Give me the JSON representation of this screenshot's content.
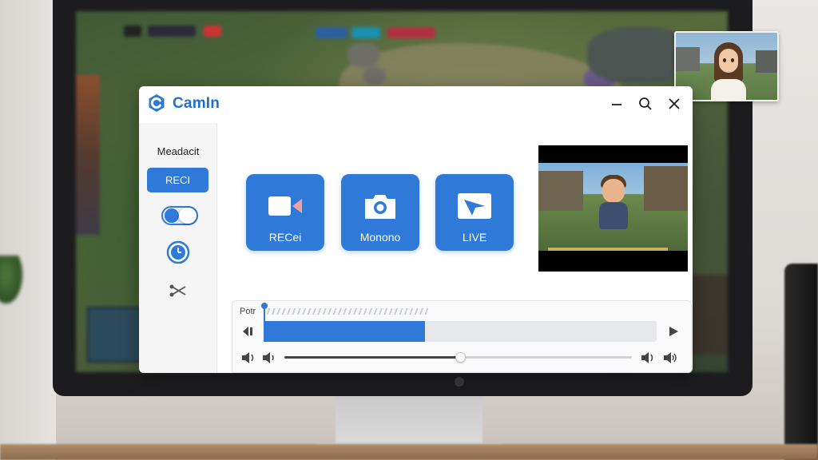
{
  "app": {
    "title": "CamIn"
  },
  "sidebar": {
    "label": "Meadacit",
    "record_button": "RECI",
    "toggle_on": true
  },
  "actions": [
    {
      "label": "RECei",
      "icon": "video-camera-icon"
    },
    {
      "label": "Monono",
      "icon": "camera-icon"
    },
    {
      "label": "LIVE",
      "icon": "live-stream-icon"
    }
  ],
  "timeline": {
    "label": "Potr",
    "clip_fraction": 0.41,
    "volume_fraction": 0.505
  },
  "colors": {
    "accent": "#2f7ad8",
    "brand": "#1f6fcf",
    "clip_marker": "#d64545"
  }
}
